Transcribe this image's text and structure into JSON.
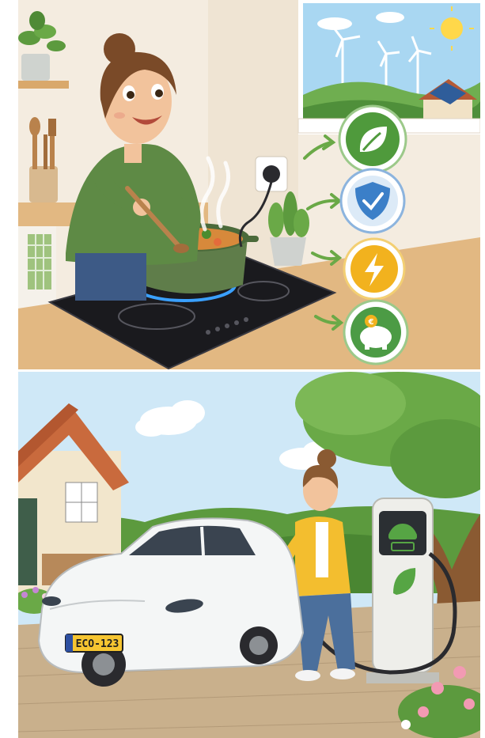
{
  "scenes": {
    "kitchen": {
      "benefit_icons": [
        "leaf-icon",
        "shield-check-icon",
        "lightning-icon",
        "piggy-bank-euro-icon"
      ],
      "euro_symbol": "€",
      "colors": {
        "wall": "#f4ece0",
        "counter": "#e2b882",
        "cooktop": "#1a1a1e",
        "burner_glow": "#3aa0ff",
        "pot": "#5f7d4a",
        "sweater": "#5e8a45",
        "leaf_badge": "#4f9a3c",
        "shield_badge": "#3b7fc8",
        "bolt_badge": "#f2b21e",
        "piggy_badge": "#4c9b45"
      }
    },
    "driveway": {
      "license_plate": "ECO-123",
      "colors": {
        "sky": "#cfe8f7",
        "car": "#f4f6f6",
        "cardigan": "#f3be2f",
        "jeans": "#4b6f9c",
        "charger": "#eeeeea",
        "charger_leaf": "#56a544",
        "roof_tiles": "#c96a3d",
        "paving": "#c9b08c"
      }
    }
  }
}
